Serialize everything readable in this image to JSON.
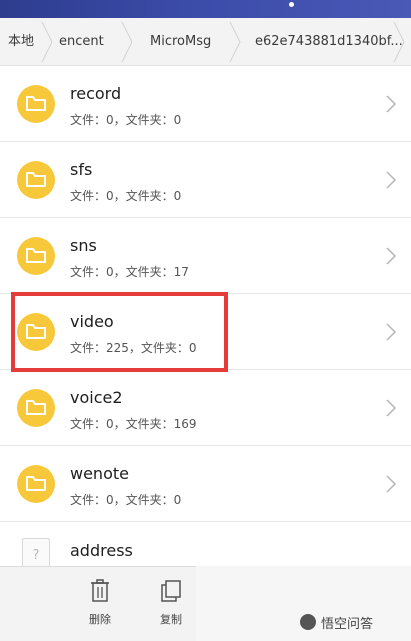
{
  "breadcrumb": {
    "items": [
      "本地",
      "encent",
      "MicroMsg",
      "e62e743881d1340bf..."
    ]
  },
  "files": [
    {
      "name": "record",
      "meta": "文件：0，文件夹：0"
    },
    {
      "name": "sfs",
      "meta": "文件：0，文件夹：0"
    },
    {
      "name": "sns",
      "meta": "文件：0，文件夹：17"
    },
    {
      "name": "video",
      "meta": "文件：225，文件夹：0"
    },
    {
      "name": "voice2",
      "meta": "文件：0，文件夹：169"
    },
    {
      "name": "wenote",
      "meta": "文件：0，文件夹：0"
    }
  ],
  "partial_file": {
    "name": "address",
    "icon_glyph": "?"
  },
  "toolbar": {
    "delete_label": "删除",
    "copy_label": "复制"
  },
  "watermark": {
    "text": "悟空问答"
  },
  "colors": {
    "folder": "#f7c93a",
    "highlight": "#e53b3b",
    "status_bar": "#3b4ba8"
  },
  "icons": {
    "folder": "folder-icon",
    "chevron": "chevron-right-icon",
    "delete": "trash-icon",
    "copy": "copy-icon",
    "unknown_file": "unknown-file-icon"
  }
}
